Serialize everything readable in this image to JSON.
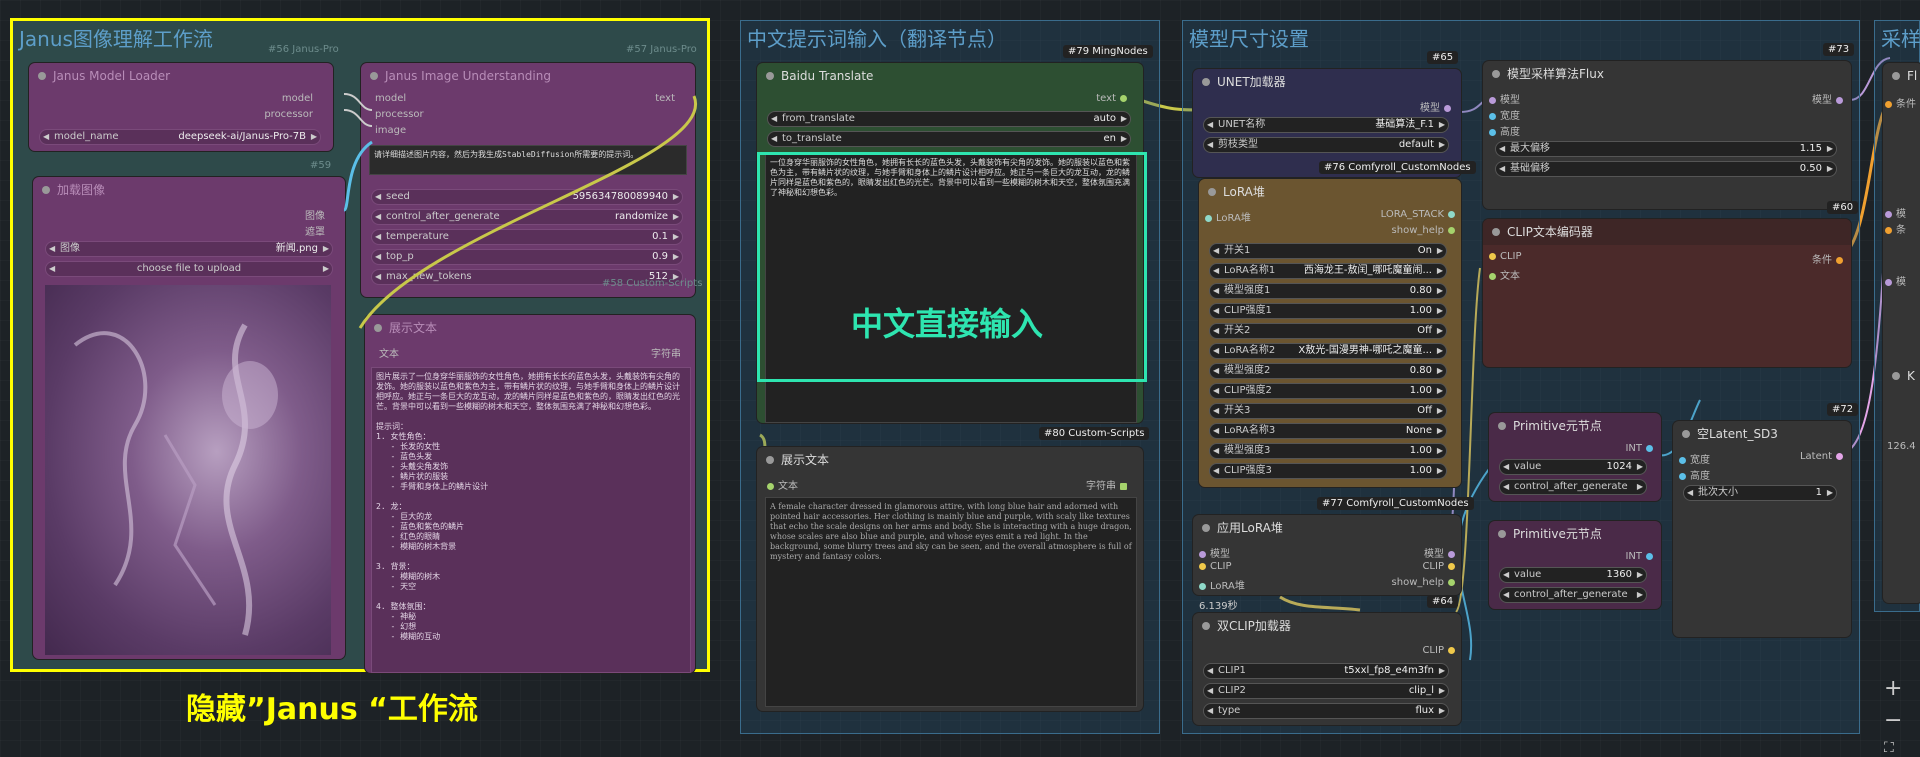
{
  "janus": {
    "title": "Janus图像理解工作流",
    "loader": {
      "title": "Janus Model Loader",
      "tag": "#56 Janus-Pro",
      "out_model": "model",
      "out_processor": "processor",
      "model_name_label": "model_name",
      "model_name_value": "deepseek-ai/Janus-Pro-7B"
    },
    "understanding": {
      "title": "Janus Image Understanding",
      "tag": "#57 Janus-Pro",
      "in_model": "model",
      "in_processor": "processor",
      "in_image": "image",
      "out_text": "text",
      "prompt": "请详细描述图片内容，然后为我生成StableDiffusion所需要的提示词。",
      "w1l": "seed",
      "w1v": "595634780089940",
      "w2l": "control_after_generate",
      "w2v": "randomize",
      "w3l": "temperature",
      "w3v": "0.1",
      "w4l": "top_p",
      "w4v": "0.9",
      "w5l": "max_new_tokens",
      "w5v": "512"
    },
    "load_image": {
      "title": "加载图像",
      "tag": "#59",
      "out_image": "图像",
      "out_mask": "遮罩",
      "w_label": "图像",
      "w_value": "新闻.png",
      "upload": "choose file to upload"
    },
    "show_text": {
      "title": "展示文本",
      "tag": "#58 Custom-Scripts",
      "in_text": "文本",
      "out_text": "字符串",
      "content": "图片展示了一位身穿华丽服饰的女性角色，她拥有长长的蓝色头发，头戴装饰有尖角的发饰。她的服装以蓝色和紫色为主，带有鳞片状的纹理，与她手臂和身体上的鳞片设计相呼应。她正与一条巨大的龙互动，龙的鳞片同样是蓝色和紫色的，眼睛发出红色的光芒。背景中可以看到一些模糊的树木和天空，整体氛围充满了神秘和幻想色彩。\n\n提示词：\n1. 女性角色：\n   - 长发的女性\n   - 蓝色头发\n   - 头戴尖角发饰\n   - 鳞片状的服装\n   - 手臂和身体上的鳞片设计\n\n2. 龙：\n   - 巨大的龙\n   - 蓝色和紫色的鳞片\n   - 红色的眼睛\n   - 模糊的树木背景\n\n3. 背景：\n   - 模糊的树木\n   - 天空\n\n4. 整体氛围：\n   - 神秘\n   - 幻想\n   - 模糊的互动"
    },
    "caption": "隐藏”Janus “工作流"
  },
  "cn": {
    "title": "中文提示词输入（翻译节点）",
    "baidu": {
      "title": "Baidu Translate",
      "tag": "#79 MingNodes",
      "out_text": "text",
      "w1l": "from_translate",
      "w1v": "auto",
      "w2l": "to_translate",
      "w2v": "en",
      "content": "一位身穿华丽服饰的女性角色，她拥有长长的蓝色头发，头戴装饰有尖角的发饰。她的服装以蓝色和紫色为主，带有鳞片状的纹理，与她手臂和身体上的鳞片设计相呼应。她正与一条巨大的龙互动，龙的鳞片同样是蓝色和紫色的，眼睛发出红色的光芒。背景中可以看到一些模糊的树木和天空，整体氛围充满了神秘和幻想色彩。",
      "overlay": "中文直接输入"
    },
    "show": {
      "title": "展示文本",
      "tag": "#80 Custom-Scripts",
      "in_text": "文本",
      "out_text": "字符串",
      "content": "A female character dressed in glamorous attire, with long blue hair and adorned with pointed hair accessories. Her clothing is mainly blue and purple, with scaly like textures that echo the scale designs on her arms and body. She is interacting with a huge dragon, whose scales are also blue and purple, and whose eyes emit a red light. In the background, some blurry trees and sky can be seen, and the overall atmosphere is full of mystery and fantasy colors."
    }
  },
  "model": {
    "title": "模型尺寸设置",
    "unet": {
      "title": "UNET加载器",
      "tag": "#65",
      "out": "模型",
      "w1l": "UNET名称",
      "w1v": "基础算法_F.1",
      "w2l": "剪枝类型",
      "w2v": "default"
    },
    "lora": {
      "title": "LoRA堆",
      "tag": "#76 Comfyroll_CustomNodes",
      "in": "LoRA堆",
      "out1": "LORA_STACK",
      "out2": "show_help",
      "rows": [
        [
          "开关1",
          "On"
        ],
        [
          "LoRA名称1",
          "西海龙王-敖闰_哪吒魔童闹..."
        ],
        [
          "模型强度1",
          "0.80"
        ],
        [
          "CLIP强度1",
          "1.00"
        ],
        [
          "开关2",
          "Off"
        ],
        [
          "LoRA名称2",
          "X敖光-国漫男神-哪吒之魔童..."
        ],
        [
          "模型强度2",
          "0.80"
        ],
        [
          "CLIP强度2",
          "1.00"
        ],
        [
          "开关3",
          "Off"
        ],
        [
          "LoRA名称3",
          "None"
        ],
        [
          "模型强度3",
          "1.00"
        ],
        [
          "CLIP强度3",
          "1.00"
        ]
      ]
    },
    "apply": {
      "title": "应用LoRA堆",
      "tag": "#77 Comfyroll_CustomNodes",
      "in1": "模型",
      "in2": "CLIP",
      "in3": "LoRA堆",
      "out1": "模型",
      "out2": "CLIP",
      "out3": "show_help",
      "time": "6.139秒"
    },
    "dualclip": {
      "title": "双CLIP加载器",
      "tag": "#64",
      "out": "CLIP",
      "w1l": "CLIP1",
      "w1v": "t5xxl_fp8_e4m3fn",
      "w2l": "CLIP2",
      "w2v": "clip_l",
      "w3l": "type",
      "w3v": "flux"
    },
    "sampling": {
      "title": "模型采样算法Flux",
      "tag": "#73",
      "in1": "模型",
      "in2": "宽度",
      "in3": "高度",
      "out": "模型",
      "w1l": "最大偏移",
      "w1v": "1.15",
      "w2l": "基础偏移",
      "w2v": "0.50"
    },
    "clipenc": {
      "title": "CLIP文本编码器",
      "tag": "#60",
      "in1": "CLIP",
      "in2": "文本",
      "out": "条件"
    },
    "prim1": {
      "title": "Primitive元节点",
      "out": "INT",
      "w1l": "value",
      "w1v": "1024",
      "w2l": "control_after_generate"
    },
    "prim2": {
      "title": "Primitive元节点",
      "out": "INT",
      "w1l": "value",
      "w1v": "1360",
      "w2l": "control_after_generate"
    },
    "latent": {
      "title": "空Latent_SD3",
      "tag": "#72",
      "in1": "宽度",
      "in2": "高度",
      "out": "Latent",
      "w1l": "批次大小",
      "w1v": "1"
    }
  },
  "sampler": {
    "title": "采样",
    "node": "Fl",
    "s1": "条件",
    "s2": "模",
    "s3": "条",
    "s4": "模",
    "k": "K",
    "num": "126.4"
  },
  "controls": {
    "plus": "+",
    "minus": "−",
    "fit": "⛶"
  }
}
